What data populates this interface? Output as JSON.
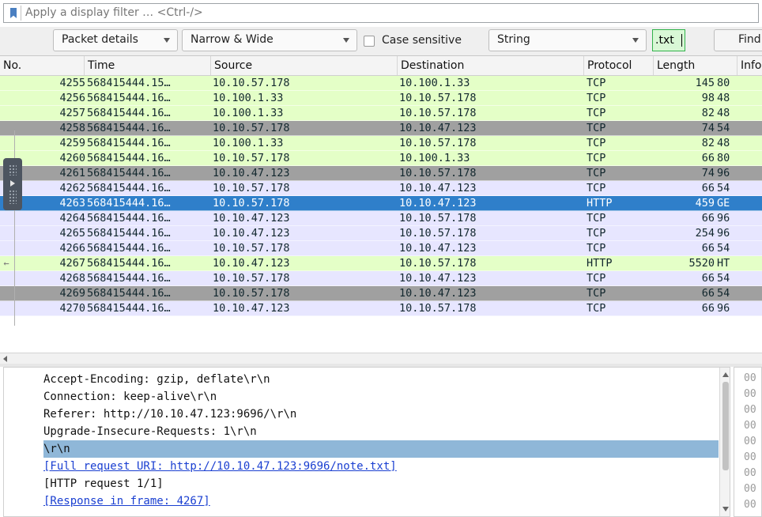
{
  "filter": {
    "placeholder": "Apply a display filter … <Ctrl-/>"
  },
  "find_bar": {
    "search_in": "Packet details",
    "char_width": "Narrow & Wide",
    "case_sensitive_label": "Case sensitive",
    "search_type": "String",
    "search_text": ".txt",
    "find_button": "Find"
  },
  "columns": [
    "No.",
    "Time",
    "Source",
    "Destination",
    "Protocol",
    "Length",
    "Info"
  ],
  "colors": {
    "tcp_green": "#e4ffc7",
    "tcp_lavender": "#e7e6ff",
    "http_green": "#e4ffc7",
    "gray": "#a0a0a0",
    "selected": "#2f7fca",
    "detail_highlight": "#8fb7d8",
    "link": "#1a3fd1"
  },
  "packets": [
    {
      "no": "4255",
      "time": "568415444.15…",
      "src": "10.10.57.178",
      "dst": "10.100.1.33",
      "proto": "TCP",
      "len": "145",
      "info": "80",
      "style": "green",
      "rel": ""
    },
    {
      "no": "4256",
      "time": "568415444.16…",
      "src": "10.100.1.33",
      "dst": "10.10.57.178",
      "proto": "TCP",
      "len": "98",
      "info": "48",
      "style": "green",
      "rel": ""
    },
    {
      "no": "4257",
      "time": "568415444.16…",
      "src": "10.100.1.33",
      "dst": "10.10.57.178",
      "proto": "TCP",
      "len": "82",
      "info": "48",
      "style": "green",
      "rel": ""
    },
    {
      "no": "4258",
      "time": "568415444.16…",
      "src": "10.10.57.178",
      "dst": "10.10.47.123",
      "proto": "TCP",
      "len": "74",
      "info": "54",
      "style": "gray",
      "rel": ""
    },
    {
      "no": "4259",
      "time": "568415444.16…",
      "src": "10.100.1.33",
      "dst": "10.10.57.178",
      "proto": "TCP",
      "len": "82",
      "info": "48",
      "style": "green",
      "rel": ""
    },
    {
      "no": "4260",
      "time": "568415444.16…",
      "src": "10.10.57.178",
      "dst": "10.100.1.33",
      "proto": "TCP",
      "len": "66",
      "info": "80",
      "style": "green",
      "rel": ""
    },
    {
      "no": "4261",
      "time": "568415444.16…",
      "src": "10.10.47.123",
      "dst": "10.10.57.178",
      "proto": "TCP",
      "len": "74",
      "info": "96",
      "style": "gray",
      "rel": ""
    },
    {
      "no": "4262",
      "time": "568415444.16…",
      "src": "10.10.57.178",
      "dst": "10.10.47.123",
      "proto": "TCP",
      "len": "66",
      "info": "54",
      "style": "lavender",
      "rel": ""
    },
    {
      "no": "4263",
      "time": "568415444.16…",
      "src": "10.10.57.178",
      "dst": "10.10.47.123",
      "proto": "HTTP",
      "len": "459",
      "info": "GE",
      "style": "selected",
      "rel": "→"
    },
    {
      "no": "4264",
      "time": "568415444.16…",
      "src": "10.10.47.123",
      "dst": "10.10.57.178",
      "proto": "TCP",
      "len": "66",
      "info": "96",
      "style": "lavender",
      "rel": ""
    },
    {
      "no": "4265",
      "time": "568415444.16…",
      "src": "10.10.47.123",
      "dst": "10.10.57.178",
      "proto": "TCP",
      "len": "254",
      "info": "96",
      "style": "lavender",
      "rel": ""
    },
    {
      "no": "4266",
      "time": "568415444.16…",
      "src": "10.10.57.178",
      "dst": "10.10.47.123",
      "proto": "TCP",
      "len": "66",
      "info": "54",
      "style": "lavender",
      "rel": ""
    },
    {
      "no": "4267",
      "time": "568415444.16…",
      "src": "10.10.47.123",
      "dst": "10.10.57.178",
      "proto": "HTTP",
      "len": "5520",
      "info": "HT",
      "style": "green",
      "rel": "←"
    },
    {
      "no": "4268",
      "time": "568415444.16…",
      "src": "10.10.57.178",
      "dst": "10.10.47.123",
      "proto": "TCP",
      "len": "66",
      "info": "54",
      "style": "lavender",
      "rel": ""
    },
    {
      "no": "4269",
      "time": "568415444.16…",
      "src": "10.10.57.178",
      "dst": "10.10.47.123",
      "proto": "TCP",
      "len": "66",
      "info": "54",
      "style": "gray",
      "rel": ""
    },
    {
      "no": "4270",
      "time": "568415444.16…",
      "src": "10.10.47.123",
      "dst": "10.10.57.178",
      "proto": "TCP",
      "len": "66",
      "info": "96",
      "style": "lavender",
      "rel": ""
    }
  ],
  "details": [
    {
      "text": "Accept-Encoding: gzip, deflate\\r\\n",
      "link": false
    },
    {
      "text": "Connection: keep-alive\\r\\n",
      "link": false
    },
    {
      "text": "Referer: http://10.10.47.123:9696/\\r\\n",
      "link": false
    },
    {
      "text": "Upgrade-Insecure-Requests: 1\\r\\n",
      "link": false
    },
    {
      "text": "\\r\\n",
      "link": false
    },
    {
      "text": "[Full request URI: http://10.10.47.123:9696/note.txt]",
      "link": true
    },
    {
      "text": "[HTTP request 1/1]",
      "link": false
    },
    {
      "text": "[Response in frame: 4267]",
      "link": true
    }
  ],
  "bytes_col": [
    "00",
    "00",
    "00",
    "00",
    "00",
    "00",
    "00",
    "00",
    "00"
  ]
}
